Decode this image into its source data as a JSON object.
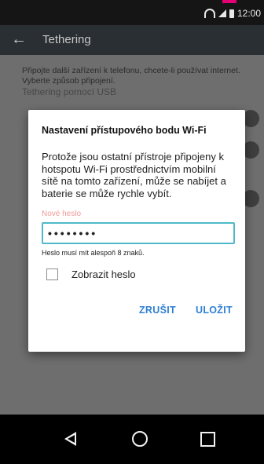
{
  "status_bar": {
    "time": "12:00"
  },
  "app_bar": {
    "title": "Tethering"
  },
  "background": {
    "intro": "Připojte další zařízení k telefonu, chcete-li používat internet. Vyberte způsob připojení.",
    "usb_tethering_label": "Tethering pomocí USB"
  },
  "dialog": {
    "title": "Nastavení přístupového bodu Wi-Fi",
    "message": "Protože jsou ostatní přístroje připojeny k hotspotu Wi-Fi prostřednictvím mobilní sítě na tomto zařízení, může se nabíjet a baterie se může rychle vybít.",
    "password_label": "Nové heslo",
    "password_value": "••••••••",
    "password_hint": "Heslo musí mít alespoň 8 znaků.",
    "show_password_label": "Zobrazit heslo",
    "show_password_checked": false,
    "cancel_label": "ZRUŠIT",
    "save_label": "ULOŽIT"
  }
}
